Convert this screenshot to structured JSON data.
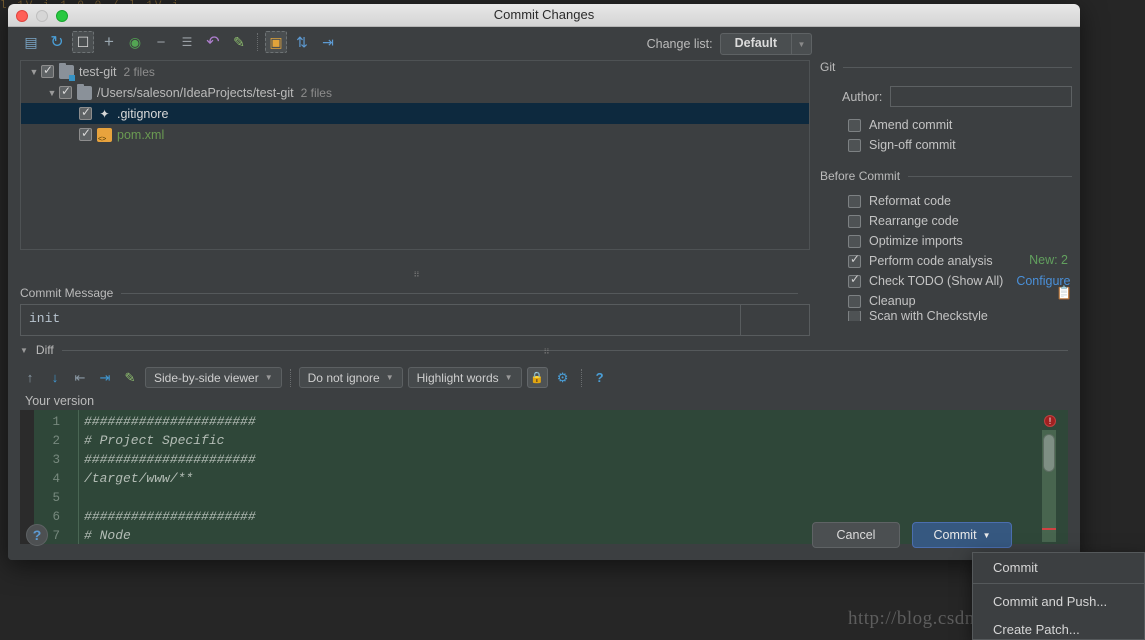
{
  "background": {
    "top_strip_text": "l 1V     i     1 0 0 /     l 1V     i",
    "watermark": "http://blog.csdn.net/Mr_rain"
  },
  "window": {
    "title": "Commit Changes",
    "traffic_lights": [
      "close-button",
      "minimize-button",
      "zoom-button"
    ]
  },
  "toolbar": {
    "icons": [
      {
        "name": "show-diff-icon",
        "glyph": "▤"
      },
      {
        "name": "refresh-icon",
        "glyph": "↻"
      },
      {
        "name": "unversioned-files-icon",
        "glyph": "?"
      },
      {
        "name": "add-icon",
        "glyph": "+"
      },
      {
        "name": "move-to-changelist-icon",
        "glyph": "◳"
      },
      {
        "name": "remove-icon",
        "glyph": "−"
      },
      {
        "name": "select-all-icon",
        "glyph": "☰"
      },
      {
        "name": "revert-icon",
        "glyph": "↶"
      },
      {
        "name": "edit-source-icon",
        "glyph": "✎"
      },
      {
        "name": "group-by-directory-icon",
        "glyph": "▣"
      },
      {
        "name": "expand-all-icon",
        "glyph": "⇵"
      },
      {
        "name": "collapse-all-icon",
        "glyph": "⇥"
      }
    ],
    "change_list_label": "Change list:",
    "change_list_value": "Default"
  },
  "file_tree": {
    "rows": [
      {
        "indent": 0,
        "twisty": "▼",
        "checked": true,
        "icon": "folder-module-icon",
        "label": "test-git",
        "count": "2 files",
        "selected": false,
        "green": false
      },
      {
        "indent": 1,
        "twisty": "▼",
        "checked": true,
        "icon": "folder-icon",
        "label": "/Users/saleson/IdeaProjects/test-git",
        "count": "2 files",
        "selected": false,
        "green": false
      },
      {
        "indent": 2,
        "twisty": "",
        "checked": true,
        "icon": "gitignore-file-icon",
        "label": ".gitignore",
        "count": "",
        "selected": true,
        "green": false
      },
      {
        "indent": 2,
        "twisty": "",
        "checked": true,
        "icon": "xml-file-icon",
        "label": "pom.xml",
        "count": "",
        "selected": false,
        "green": true
      }
    ],
    "new_count": "New: 2"
  },
  "commit_message": {
    "section_label": "Commit Message",
    "value": "init",
    "placeholder": ""
  },
  "diff": {
    "section_label": "Diff",
    "toolbar_icons": [
      {
        "name": "previous-difference-icon",
        "glyph": "↑"
      },
      {
        "name": "next-difference-icon",
        "glyph": "↓"
      },
      {
        "name": "accept-left-icon",
        "glyph": "⇤"
      },
      {
        "name": "accept-right-icon",
        "glyph": "⇥"
      },
      {
        "name": "edit-source-icon",
        "glyph": "✎"
      }
    ],
    "viewer_mode": "Side-by-side viewer",
    "ignore_mode": "Do not ignore",
    "highlight_mode": "Highlight words",
    "lock_icon": "lock-icon",
    "settings_icon": "gear-icon",
    "help_icon": "question-icon",
    "pane_label": "Your version",
    "code_lines": [
      {
        "n": "1",
        "text": "######################",
        "italic": true
      },
      {
        "n": "2",
        "text": "# Project Specific",
        "italic": true
      },
      {
        "n": "3",
        "text": "######################",
        "italic": true
      },
      {
        "n": "4",
        "text": "/target/www/**",
        "italic": true
      },
      {
        "n": "5",
        "text": "",
        "italic": true
      },
      {
        "n": "6",
        "text": "######################",
        "italic": true
      },
      {
        "n": "7",
        "text": "# Node",
        "italic": true
      }
    ]
  },
  "git_panel": {
    "title": "Git",
    "author_label": "Author:",
    "author_value": "",
    "options": [
      {
        "label": "Amend commit",
        "checked": false
      },
      {
        "label": "Sign-off commit",
        "checked": false
      }
    ],
    "before_commit_title": "Before Commit",
    "before_commit_options": [
      {
        "label": "Reformat code",
        "checked": false,
        "link": ""
      },
      {
        "label": "Rearrange code",
        "checked": false,
        "link": ""
      },
      {
        "label": "Optimize imports",
        "checked": false,
        "link": ""
      },
      {
        "label": "Perform code analysis",
        "checked": true,
        "link": ""
      },
      {
        "label": "Check TODO (Show All)",
        "checked": true,
        "link": "Configure"
      },
      {
        "label": "Cleanup",
        "checked": false,
        "link": ""
      },
      {
        "label": "Scan with Checkstyle",
        "checked": false,
        "link": ""
      }
    ]
  },
  "footer": {
    "help_label": "?",
    "cancel_label": "Cancel",
    "commit_label": "Commit"
  },
  "commit_menu": {
    "items": [
      "Commit",
      "Commit and Push...",
      "Create Patch..."
    ]
  }
}
